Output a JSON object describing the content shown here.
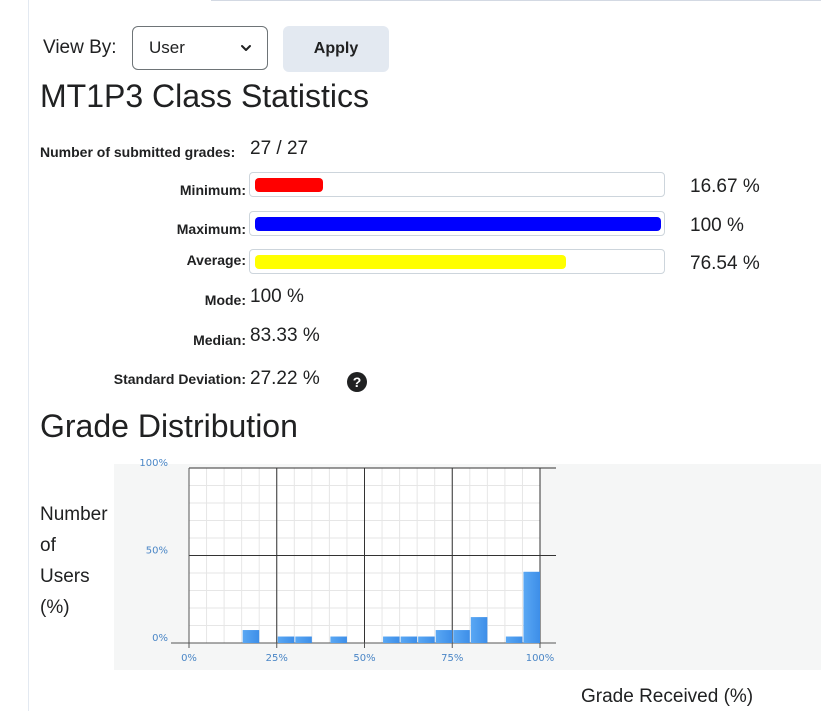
{
  "view_by": {
    "label": "View By:",
    "selected": "User",
    "apply_label": "Apply"
  },
  "page_title": "MT1P3 Class Statistics",
  "stats": {
    "submitted_label": "Number of submitted grades:",
    "submitted_value": "27 / 27",
    "minimum_label": "Minimum:",
    "minimum_value": "16.67 %",
    "minimum_fraction": 0.1667,
    "maximum_label": "Maximum:",
    "maximum_value": "100 %",
    "maximum_fraction": 1.0,
    "average_label": "Average:",
    "average_value": "76.54 %",
    "average_fraction": 0.7654,
    "mode_label": "Mode:",
    "mode_value": "100 %",
    "median_label": "Median:",
    "median_value": "83.33 %",
    "stddev_label": "Standard Deviation:",
    "stddev_value": "27.22 %",
    "help_glyph": "?"
  },
  "colors": {
    "minimum": "#ff0000",
    "maximum": "#0000ff",
    "average": "#ffff00",
    "bar": "#3d8ee8"
  },
  "distribution_title": "Grade Distribution",
  "y_axis_label": [
    "Number",
    "of",
    "Users",
    "(%)"
  ],
  "x_axis_label": "Grade Received (%)",
  "chart_data": {
    "type": "bar",
    "ylabel": "Number of Users (%)",
    "xlabel": "Grade Received (%)",
    "y_ticks": [
      "0%",
      "50%",
      "100%"
    ],
    "x_ticks": [
      "0%",
      "25%",
      "50%",
      "75%",
      "100%"
    ],
    "xlim": [
      0,
      100
    ],
    "ylim": [
      0,
      100
    ],
    "grid": true,
    "bins": [
      {
        "x": [
          15,
          20
        ],
        "value": 7.4
      },
      {
        "x": [
          25,
          30
        ],
        "value": 3.7
      },
      {
        "x": [
          30,
          35
        ],
        "value": 3.7
      },
      {
        "x": [
          40,
          45
        ],
        "value": 3.7
      },
      {
        "x": [
          55,
          60
        ],
        "value": 3.7
      },
      {
        "x": [
          60,
          65
        ],
        "value": 3.7
      },
      {
        "x": [
          65,
          70
        ],
        "value": 3.7
      },
      {
        "x": [
          70,
          75
        ],
        "value": 7.4
      },
      {
        "x": [
          75,
          80
        ],
        "value": 7.4
      },
      {
        "x": [
          80,
          85
        ],
        "value": 14.8
      },
      {
        "x": [
          90,
          95
        ],
        "value": 3.7
      },
      {
        "x": [
          95,
          100
        ],
        "value": 40.7
      }
    ]
  }
}
